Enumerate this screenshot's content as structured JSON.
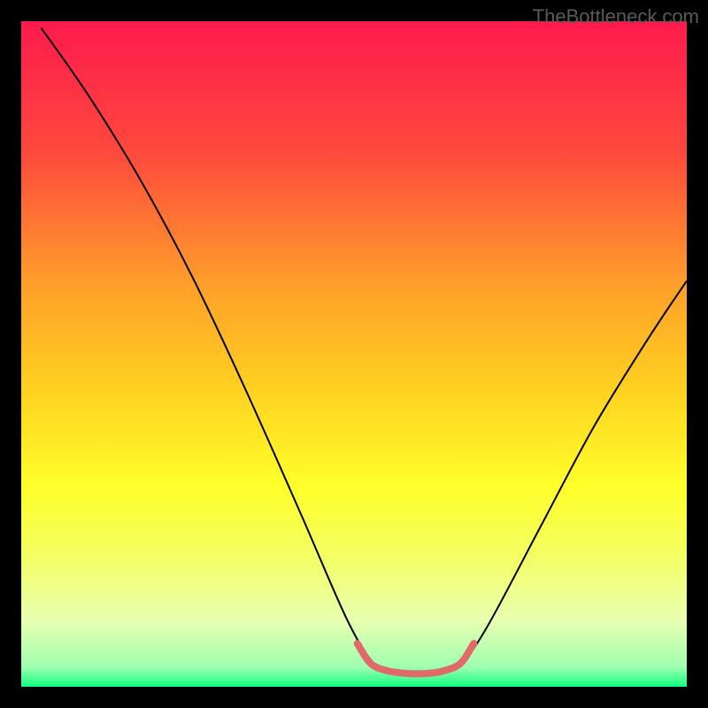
{
  "watermark": "TheBottleneck.com",
  "chart_data": {
    "type": "line",
    "title": "",
    "xlabel": "",
    "ylabel": "",
    "xlim": [
      0,
      100
    ],
    "ylim": [
      0,
      100
    ],
    "grid": false,
    "legend": false,
    "background": {
      "type": "vertical-gradient",
      "stops": [
        {
          "pos": 0.0,
          "color": "#ff1a4d"
        },
        {
          "pos": 0.2,
          "color": "#ff4a3d"
        },
        {
          "pos": 0.4,
          "color": "#ffa02a"
        },
        {
          "pos": 0.55,
          "color": "#ffd020"
        },
        {
          "pos": 0.7,
          "color": "#ffff2a"
        },
        {
          "pos": 0.8,
          "color": "#f4ff60"
        },
        {
          "pos": 0.9,
          "color": "#e8ffb0"
        },
        {
          "pos": 0.97,
          "color": "#a0ffb0"
        },
        {
          "pos": 1.0,
          "color": "#10ff80"
        }
      ]
    },
    "series": [
      {
        "name": "curve",
        "color": "#000000",
        "width": 2,
        "points": [
          {
            "x": 3.0,
            "y": 99.0
          },
          {
            "x": 10.0,
            "y": 89.0
          },
          {
            "x": 18.0,
            "y": 76.0
          },
          {
            "x": 26.0,
            "y": 61.0
          },
          {
            "x": 34.0,
            "y": 44.0
          },
          {
            "x": 42.0,
            "y": 26.0
          },
          {
            "x": 49.0,
            "y": 10.0
          },
          {
            "x": 53.0,
            "y": 3.5
          },
          {
            "x": 56.0,
            "y": 2.0
          },
          {
            "x": 62.0,
            "y": 2.0
          },
          {
            "x": 66.0,
            "y": 3.5
          },
          {
            "x": 70.0,
            "y": 9.0
          },
          {
            "x": 78.0,
            "y": 24.0
          },
          {
            "x": 86.0,
            "y": 39.0
          },
          {
            "x": 94.0,
            "y": 52.0
          },
          {
            "x": 100.0,
            "y": 61.0
          }
        ]
      },
      {
        "name": "bottom-highlight",
        "color": "#e06a6a",
        "width": 8,
        "linecap": "round",
        "points": [
          {
            "x": 50.5,
            "y": 6.5
          },
          {
            "x": 52.5,
            "y": 3.5
          },
          {
            "x": 55.0,
            "y": 2.4
          },
          {
            "x": 58.0,
            "y": 2.0
          },
          {
            "x": 61.0,
            "y": 2.0
          },
          {
            "x": 63.5,
            "y": 2.4
          },
          {
            "x": 66.0,
            "y": 3.5
          },
          {
            "x": 68.0,
            "y": 6.5
          }
        ]
      }
    ]
  }
}
